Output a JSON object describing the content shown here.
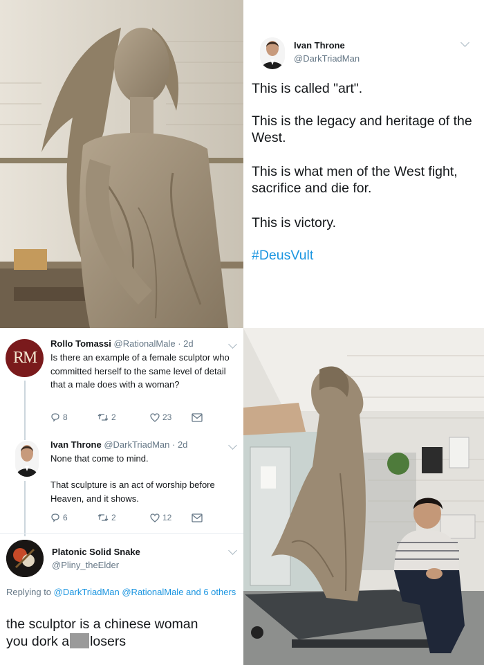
{
  "colors": {
    "link": "#1b95e0",
    "muted": "#657786",
    "text": "#14171a",
    "clay": "#9a8c77"
  },
  "top_tweet": {
    "name": "Ivan Throne",
    "handle": "@DarkTriadMan",
    "lines": [
      "This is called \"art\".",
      "This is the legacy and heritage of the West.",
      "This is what men of the West fight, sacrifice and die for.",
      "This is victory."
    ],
    "hashtag": "#DeusVult"
  },
  "reply1": {
    "avatar_text": "RM",
    "name": "Rollo Tomassi",
    "handle": "@RationalMale",
    "time": "· 2d",
    "text": "Is there an example of a female sculptor who committed herself to the same level of detail that a male does with a woman?",
    "reply_count": "8",
    "retweet_count": "2",
    "like_count": "23"
  },
  "reply2": {
    "name": "Ivan Throne",
    "handle": "@DarkTriadMan",
    "time": "· 2d",
    "line1": "None that come to mind.",
    "line2": "That sculpture is an act of worship before Heaven, and it shows.",
    "reply_count": "6",
    "retweet_count": "2",
    "like_count": "12"
  },
  "reply3": {
    "name": "Platonic Solid Snake",
    "handle": "@Pliny_theElder",
    "replying_prefix": "Replying to",
    "replying_users": "@DarkTriadMan @RationalMale and 6 others",
    "text_line1": "the sculptor is a chinese woman",
    "text_line2a": "you dork a",
    "text_line2b": "losers"
  }
}
